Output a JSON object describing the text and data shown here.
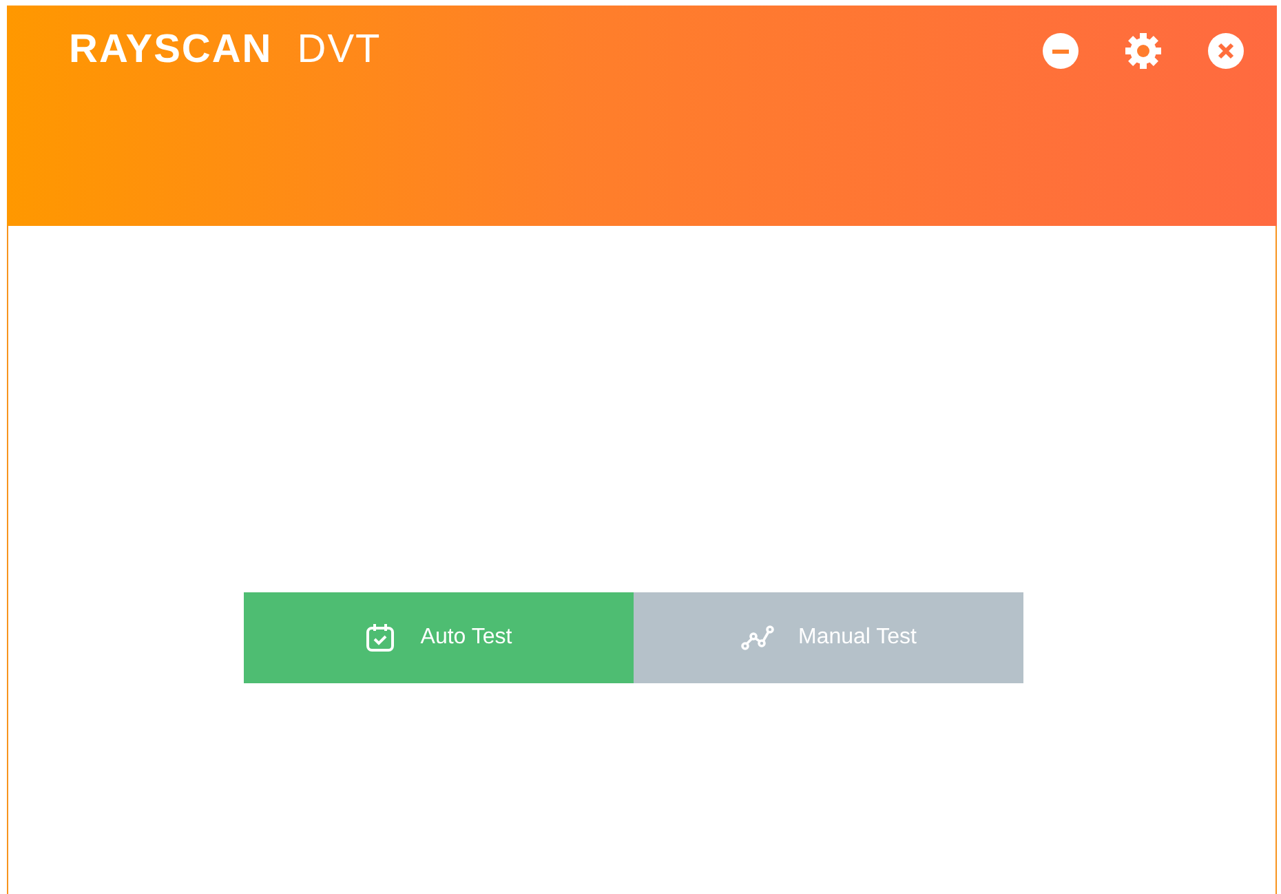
{
  "header": {
    "brand": "RAYSCAN",
    "product": "DVT"
  },
  "modes": [
    {
      "label": "Auto Test",
      "kind": "calendar",
      "selected": true
    },
    {
      "label": "Manual Test",
      "kind": "graph",
      "selected": false
    }
  ]
}
